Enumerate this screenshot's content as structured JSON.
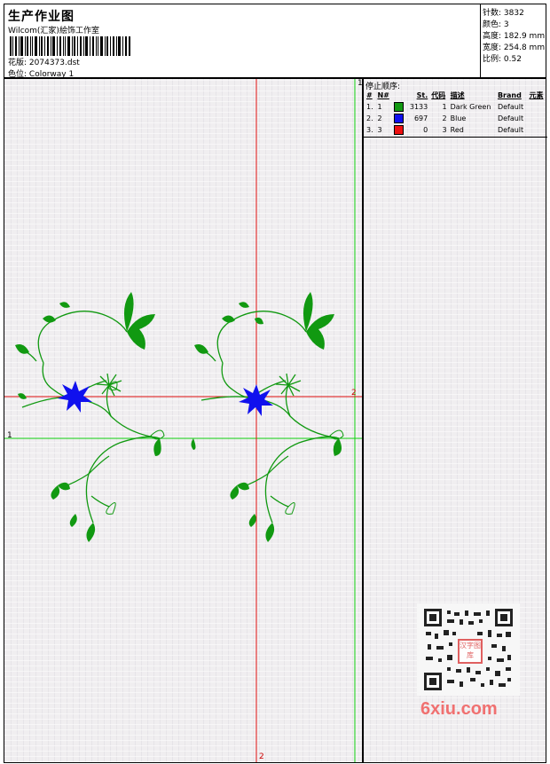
{
  "header": {
    "title": "生产作业图",
    "company": "Wilcom(汇家)絵饰工作室",
    "design_label": "花版:",
    "design_value": "2074373.dst",
    "colorway_label": "色位:",
    "colorway_value": "Colorway 1"
  },
  "specs": [
    {
      "label": "针数:",
      "value": "3832"
    },
    {
      "label": "颜色:",
      "value": "3"
    },
    {
      "label": "高度:",
      "value": "182.9 mm"
    },
    {
      "label": "宽度:",
      "value": "254.8 mm"
    },
    {
      "label": "比例:",
      "value": "0.52"
    }
  ],
  "stop_sequence": {
    "title": "停止顺序:",
    "columns": [
      "#",
      "N#",
      "St.",
      "代码",
      "描述",
      "Brand",
      "元素"
    ],
    "rows": [
      {
        "num": "1.",
        "n": "1",
        "color": "#119911",
        "st": "3133",
        "code": "1",
        "desc": "Dark Green",
        "brand": "Default"
      },
      {
        "num": "2.",
        "n": "2",
        "color": "#1010ee",
        "st": "697",
        "code": "2",
        "desc": "Blue",
        "brand": "Default"
      },
      {
        "num": "3.",
        "n": "3",
        "color": "#ee1111",
        "st": "0",
        "code": "3",
        "desc": "Red",
        "brand": "Default"
      }
    ]
  },
  "axes": {
    "green_top": "1",
    "green_left": "1",
    "red_right": "2",
    "red_bottom": "2"
  },
  "colors": {
    "dark_green": "#119911",
    "blue": "#1010ee",
    "red_guide": "#e01010",
    "green_guide": "#10d010"
  },
  "watermark": {
    "site": "6xiu.com",
    "stamp": "汉字图库"
  }
}
